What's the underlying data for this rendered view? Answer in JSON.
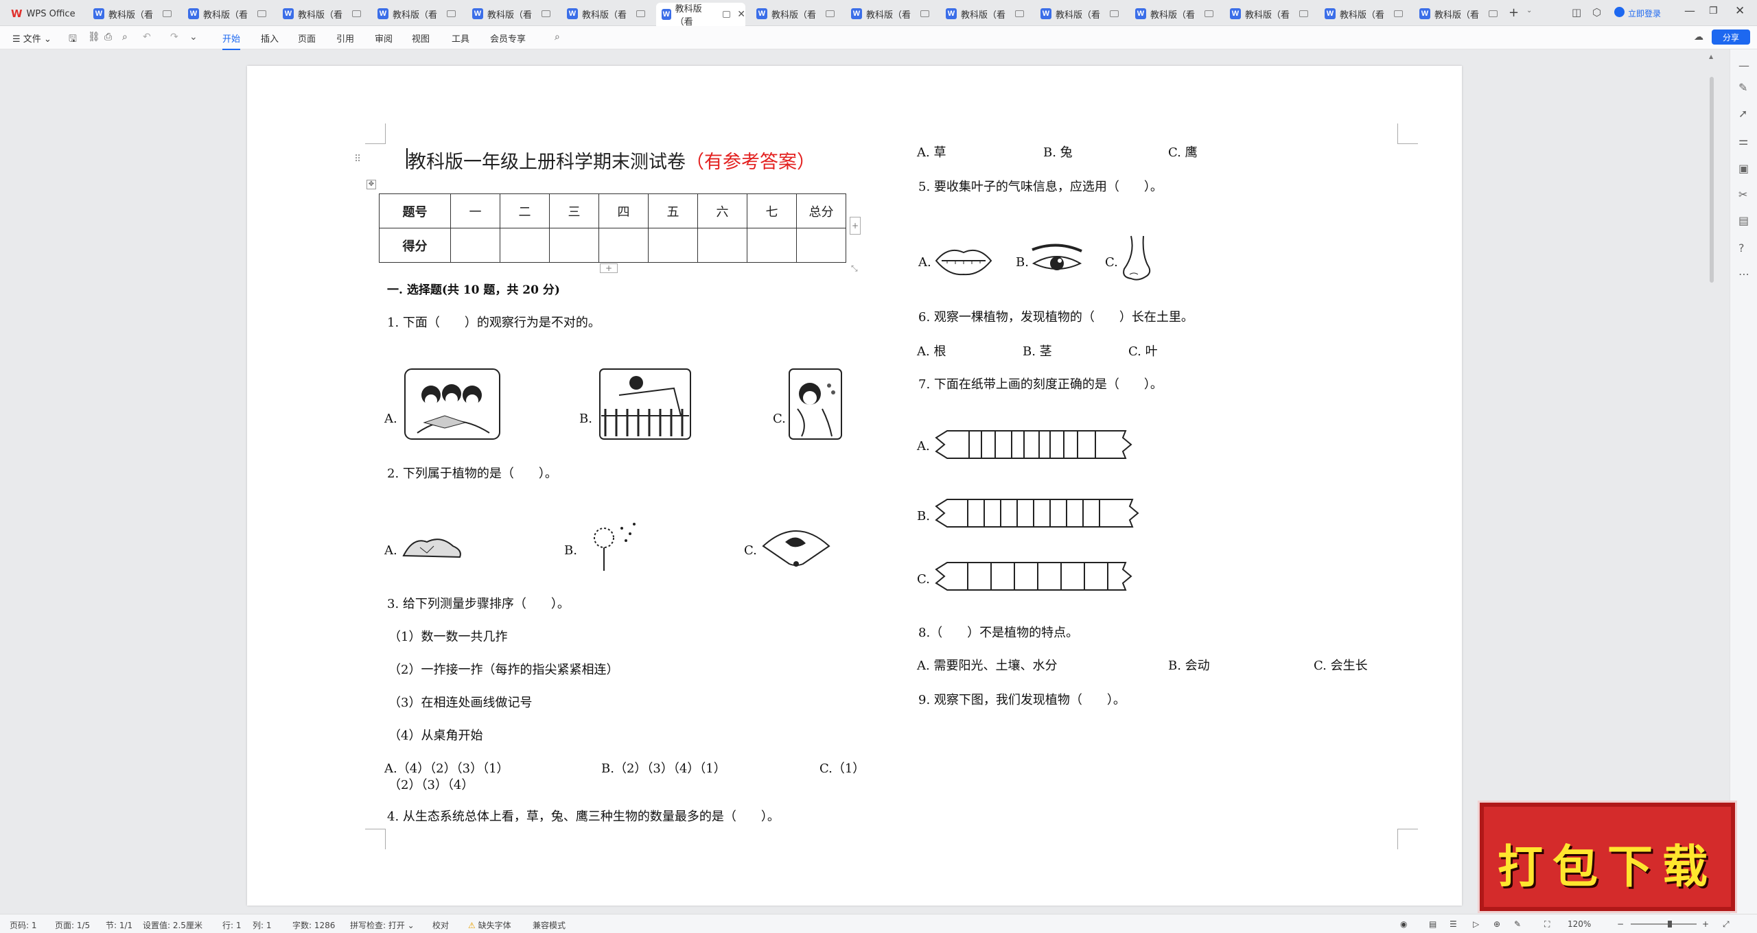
{
  "tabs": {
    "home": "WPS Office",
    "doc": "教科版（看",
    "active": "教科版（看"
  },
  "header_right": {
    "login": "立即登录",
    "share": "分享"
  },
  "menu": {
    "file": "文件",
    "items": [
      "开始",
      "插入",
      "页面",
      "引用",
      "审阅",
      "视图",
      "工具",
      "会员专享"
    ]
  },
  "doc": {
    "title_main": "教科版一年级上册科学期末测试卷",
    "title_suffix": "（有参考答案）",
    "score_row1": [
      "题号",
      "一",
      "二",
      "三",
      "四",
      "五",
      "六",
      "七",
      "总分"
    ],
    "score_row2": [
      "得分"
    ],
    "section1": "一. 选择题(共 10 题，共 20 分)",
    "q1": "1. 下面（　　）的观察行为是不对的。",
    "q1_opts": [
      "A.",
      "B.",
      "C."
    ],
    "q2": "2. 下列属于植物的是（　　）。",
    "q2_opts": [
      "A.",
      "B.",
      "C."
    ],
    "q3": "3. 给下列测量步骤排序（　　）。",
    "q3_steps": [
      "（1）数一数一共几拃",
      "（2）一拃接一拃（每拃的指尖紧紧相连）",
      "（3）在相连处画线做记号",
      "（4）从桌角开始"
    ],
    "q3_opts": [
      "A.（4）（2）（3）（1）",
      "B.（2）（3）（4）（1）",
      "C.（1）",
      "（2）（3）（4）"
    ],
    "q4": "4. 从生态系统总体上看，草，兔、鹰三种生物的数量最多的是（　　）。",
    "q4_opts": [
      "A. 草",
      "B. 兔",
      "C. 鹰"
    ],
    "q5": "5. 要收集叶子的气味信息，应选用（　　）。",
    "q5_opts": [
      "A.",
      "B.",
      "C."
    ],
    "q6": "6. 观察一棵植物，发现植物的（　　）长在土里。",
    "q6_opts": [
      "A. 根",
      "B. 茎",
      "C. 叶"
    ],
    "q7": "7. 下面在纸带上画的刻度正确的是（　　）。",
    "q7_opts": [
      "A.",
      "B.",
      "C."
    ],
    "q8": "8.（　　）不是植物的特点。",
    "q8_opts": [
      "A. 需要阳光、土壤、水分",
      "B. 会动",
      "C. 会生长"
    ],
    "q9": "9. 观察下图，我们发现植物（　　）。"
  },
  "status": {
    "page": "页码: 1",
    "pages": "页面: 1/5",
    "section": "节: 1/1",
    "setting": "设置值: 2.5厘米",
    "row": "行: 1",
    "col": "列: 1",
    "words": "字数: 1286",
    "spell": "拼写检查: 打开",
    "proof": "校对",
    "font": "缺失字体",
    "compat": "兼容模式",
    "zoom": "120%"
  },
  "banner": "打包下载"
}
